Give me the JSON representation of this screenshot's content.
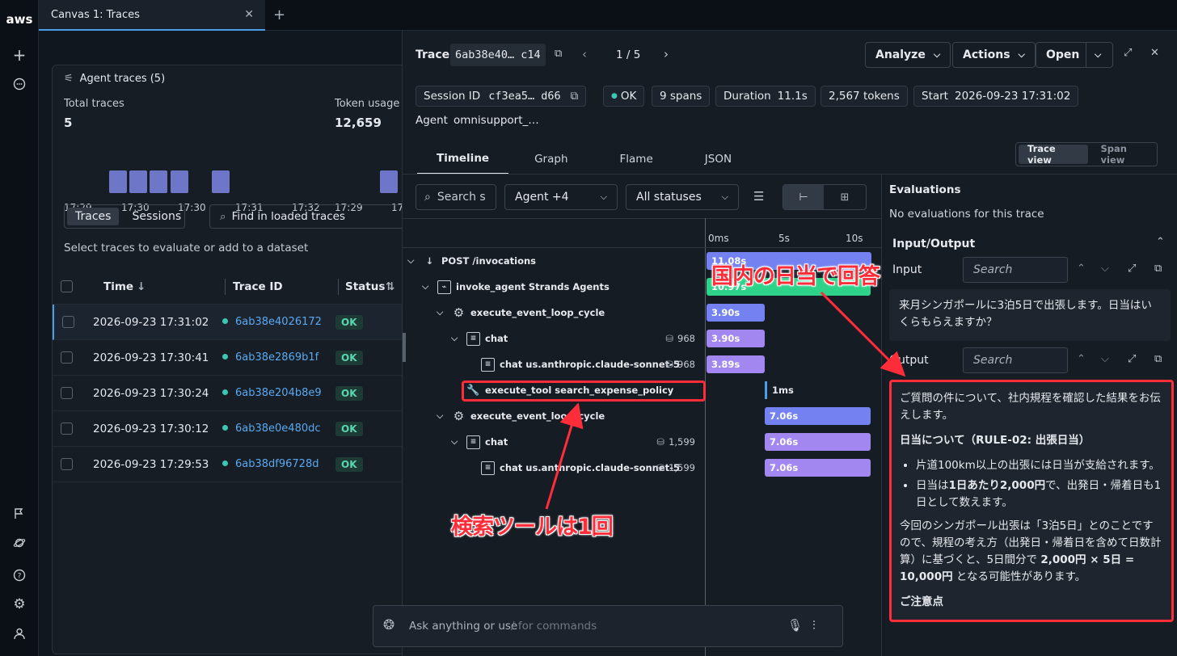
{
  "app": {
    "logo": "aws"
  },
  "window": {
    "tab_title": "Canvas 1: Traces"
  },
  "left_panel": {
    "title": "Agent traces (5)",
    "total_traces_label": "Total traces",
    "total_traces_value": "5",
    "token_usage_label": "Token usage",
    "token_usage_value": "12,659",
    "histogram_ticks": [
      "17:29",
      "17:30",
      "17:30",
      "17:31",
      "17:32"
    ],
    "token_ticks": [
      "17:29",
      "17:"
    ],
    "seg_traces": "Traces",
    "seg_sessions": "Sessions",
    "find_placeholder": "Find in loaded traces",
    "hint": "Select traces to evaluate or add to a dataset",
    "columns": {
      "time": "Time",
      "trace_id": "Trace ID",
      "status": "Status"
    },
    "rows": [
      {
        "time": "2026-09-23 17:31:02",
        "id": "6ab38e4026172",
        "status": "OK"
      },
      {
        "time": "2026-09-23 17:30:41",
        "id": "6ab38e2869b1f",
        "status": "OK"
      },
      {
        "time": "2026-09-23 17:30:24",
        "id": "6ab38e204b8e9",
        "status": "OK"
      },
      {
        "time": "2026-09-23 17:30:12",
        "id": "6ab38e0e480dc",
        "status": "OK"
      },
      {
        "time": "2026-09-23 17:29:53",
        "id": "6ab38df96728d",
        "status": "OK"
      }
    ]
  },
  "trace": {
    "label": "Trace",
    "id": "6ab38e40… c14",
    "pager": "1 / 5",
    "analyze": "Analyze",
    "actions": "Actions",
    "open": "Open",
    "session_label": "Session ID",
    "session_id": "cf3ea5… d66",
    "status": "OK",
    "spans": "9 spans",
    "duration_label": "Duration",
    "duration": "11.1s",
    "tokens": "2,567 tokens",
    "start_label": "Start",
    "start": "2026-09-23 17:31:02",
    "agent_label": "Agent",
    "agent": "omnisupport_…",
    "tabs": [
      "Timeline",
      "Graph",
      "Flame",
      "JSON"
    ],
    "view_trace": "Trace view",
    "view_span": "Span view",
    "filter_search": "Search s",
    "filter_agent": "Agent +4",
    "filter_status": "All statuses",
    "axis": [
      "0ms",
      "5s",
      "10s"
    ],
    "spans_list": [
      {
        "name": "POST /invocations",
        "tok": "",
        "bar": "11.08s"
      },
      {
        "name": "invoke_agent Strands Agents",
        "tok": "",
        "bar": "10.97s"
      },
      {
        "name": "execute_event_loop_cycle",
        "tok": "",
        "bar": "3.90s"
      },
      {
        "name": "chat",
        "tok": "968",
        "bar": "3.90s"
      },
      {
        "name": "chat us.anthropic.claude-sonnet-5",
        "tok": "968",
        "bar": "3.89s"
      },
      {
        "name": "execute_tool search_expense_policy",
        "tok": "",
        "bar": "1ms"
      },
      {
        "name": "execute_event_loop_cycle",
        "tok": "",
        "bar": "7.06s"
      },
      {
        "name": "chat",
        "tok": "1,599",
        "bar": "7.06s"
      },
      {
        "name": "chat us.anthropic.claude-sonnet-5",
        "tok": "1,599",
        "bar": "7.06s"
      }
    ]
  },
  "evaluations": {
    "title": "Evaluations",
    "empty": "No evaluations for this trace"
  },
  "io": {
    "title": "Input/Output",
    "input_label": "Input",
    "output_label": "Output",
    "search": "Search",
    "input_text": "来月シンガポールに3泊5日で出張します。日当はいくらもらえますか？",
    "out_p1": "ご質問の件について、社内規程を確認した結果をお伝えします。",
    "out_h1": "日当について（RULE-02: 出張日当）",
    "out_li1": "片道100km以上の出張には日当が支給されます。",
    "out_li2_a": "日当は",
    "out_li2_b": "1日あたり2,000円",
    "out_li2_c": "で、出発日・帰着日も1日として数えます。",
    "out_p2_a": "今回のシンガポール出張は「3泊5日」とのことですので、規程の考え方（出発日・帰着日を含めて日数計算）に基づくと、5日間分で ",
    "out_p2_b": "2,000円 × 5日 = 10,000円",
    "out_p2_c": " となる可能性があります。",
    "out_h2": "ご注意点"
  },
  "chat_input": {
    "placeholder": "Ask anything or use",
    "hint": "/ for commands"
  },
  "annotations": {
    "a1": "国内の日当で回答",
    "a2": "検索ツールは1回"
  }
}
